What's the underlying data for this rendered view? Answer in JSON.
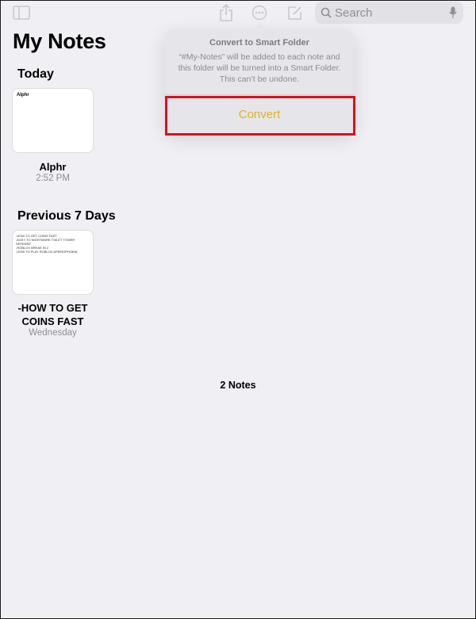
{
  "toolbar": {
    "sidebar_icon": "sidebar-icon",
    "share_icon": "share-icon",
    "more_icon": "ellipsis-circle-icon",
    "compose_icon": "compose-icon",
    "search_placeholder": "Search",
    "mic_icon": "microphone-icon"
  },
  "folder": {
    "title": "My Notes"
  },
  "sections": [
    {
      "title": "Today",
      "notes": [
        {
          "thumb_title": "Alphr",
          "title": "Alphr",
          "date": "2:52 PM"
        }
      ]
    },
    {
      "title": "Previous 7 Days",
      "notes": [
        {
          "thumb_lines": "-HOW TO GET COINS FAST\n-EASY TO NIGHTMARE TOILET TOWER\nDEFENSE\n-ROBLOX BREAK IN 2\n-HOW TO PLAY ROBLOX APEIROPHOBIA",
          "title_line1": "-HOW TO GET",
          "title_line2": "COINS FAST",
          "date": "Wednesday"
        }
      ]
    }
  ],
  "footer": {
    "count": "2 Notes"
  },
  "popover": {
    "title": "Convert to Smart Folder",
    "message": "“#My-Notes” will be added to each note and this folder will be turned into a Smart Folder. This can’t be undone.",
    "action_label": "Convert"
  },
  "colors": {
    "background": "#efeff4",
    "accent": "#e0b322",
    "highlight": "#d9101d",
    "toolbar_icon": "#c7c7cc"
  }
}
